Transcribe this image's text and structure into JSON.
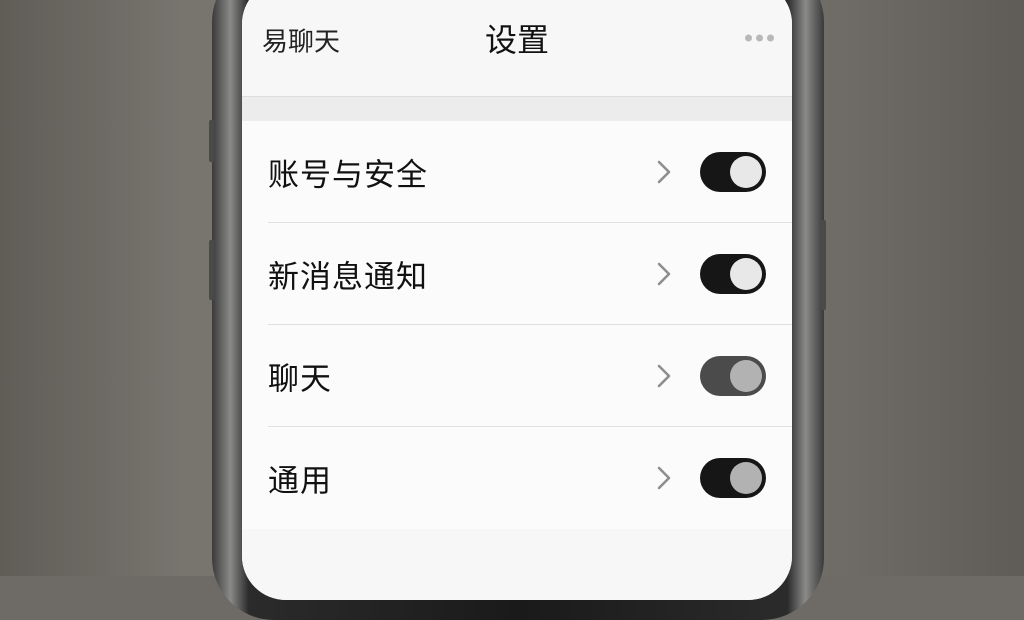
{
  "nav": {
    "back_label": "易聊天",
    "title": "设置",
    "more_icon": "more-horizontal-icon"
  },
  "settings": {
    "items": [
      {
        "label": "账号与安全",
        "toggle_state": "on",
        "toggle_style": "dark"
      },
      {
        "label": "新消息通知",
        "toggle_state": "on",
        "toggle_style": "dark"
      },
      {
        "label": "聊天",
        "toggle_state": "on",
        "toggle_style": "dim"
      },
      {
        "label": "通用",
        "toggle_state": "on",
        "toggle_style": "dark-grey-knob"
      }
    ]
  },
  "colors": {
    "screen_background": "#f7f7f7",
    "toggle_track": "#161616",
    "toggle_track_dim": "#4b4b4b",
    "chevron": "#8e8e8e"
  }
}
